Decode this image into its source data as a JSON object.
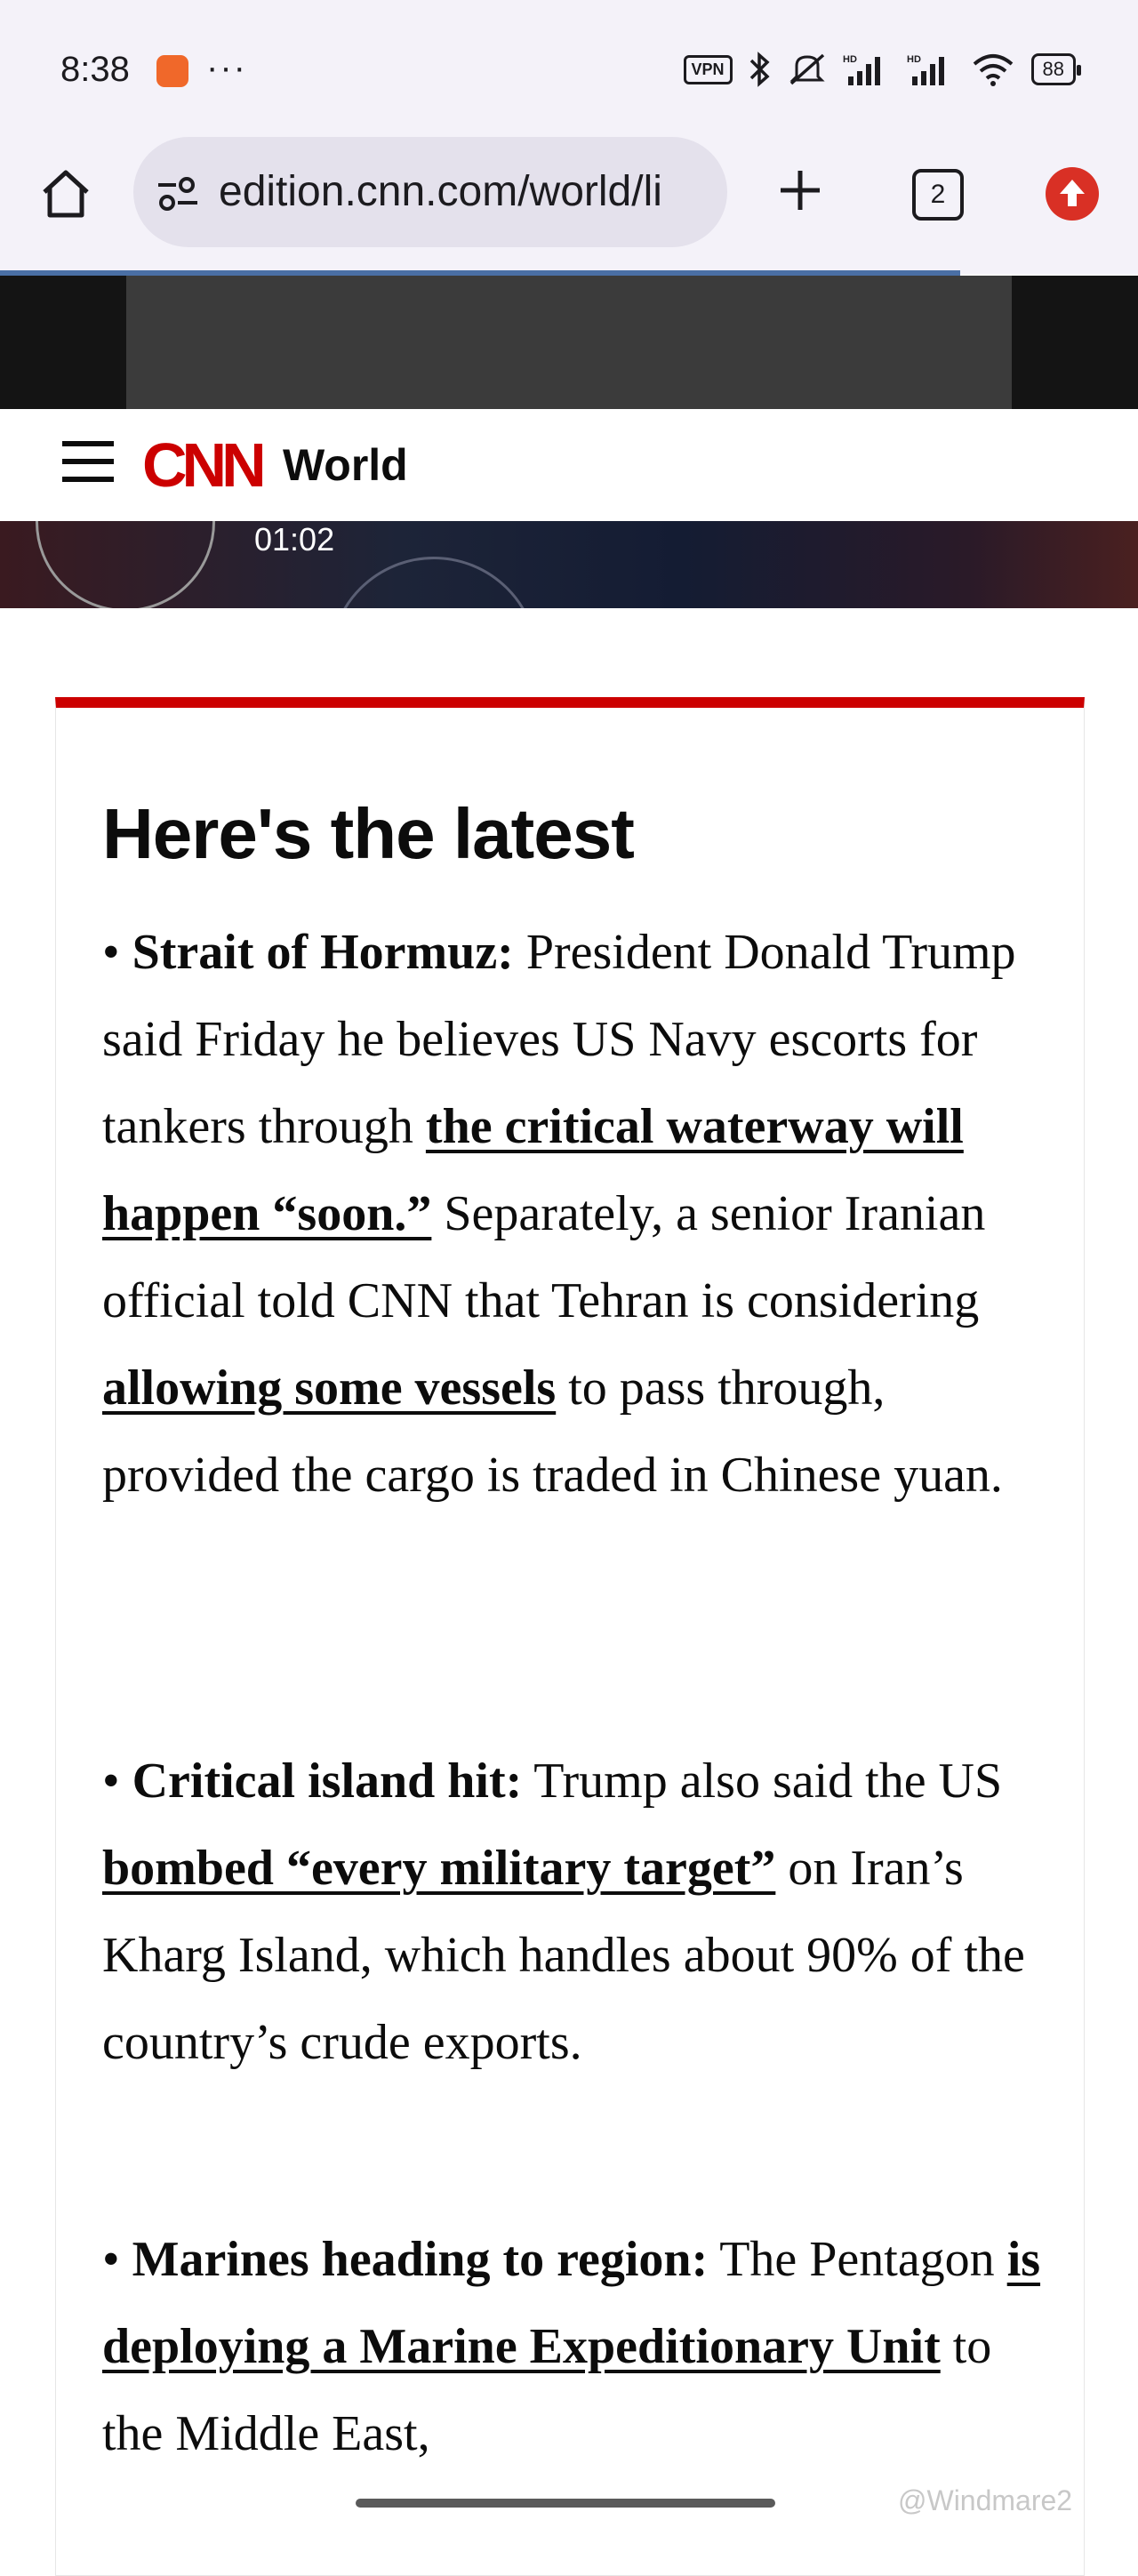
{
  "status_bar": {
    "time": "8:38",
    "dots": "···",
    "vpn": "VPN",
    "battery": "88"
  },
  "browser": {
    "url": "edition.cnn.com/world/li",
    "tab_count": "2"
  },
  "header": {
    "logo": "CNN",
    "section": "World"
  },
  "video": {
    "time": "01:02"
  },
  "latest": {
    "title": "Here's the latest",
    "items": [
      {
        "bullet": "• ",
        "heading": "Strait of Hormuz:",
        "t1": " President Donald Trump said Friday he believes US Navy escorts for tankers through ",
        "link1": "the critical waterway will happen “soon.”",
        "t2": " Separately, a senior Iranian official told CNN that Tehran is considering ",
        "link2": "allowing some vessels",
        "t3": " to pass through, provided the cargo is traded in Chinese yuan."
      },
      {
        "bullet": "• ",
        "heading": "Critical island hit:",
        "t1": " Trump also said the US ",
        "link1": "bombed “every military target”",
        "t2": " on Iran’s Kharg Island, which handles about 90% of the country’s crude exports."
      },
      {
        "bullet": "• ",
        "heading": "Marines heading to region:",
        "t1": " The Pentagon ",
        "link1": "is deploying a Marine Expeditionary Unit",
        "t2": " to the Middle East,"
      }
    ]
  },
  "watermark": "@Windmare2",
  "colors": {
    "cnn_red": "#cc0000",
    "browser_chrome": "#f4f2f9",
    "url_bar": "#e4e1ec",
    "update_badge": "#d93025"
  }
}
